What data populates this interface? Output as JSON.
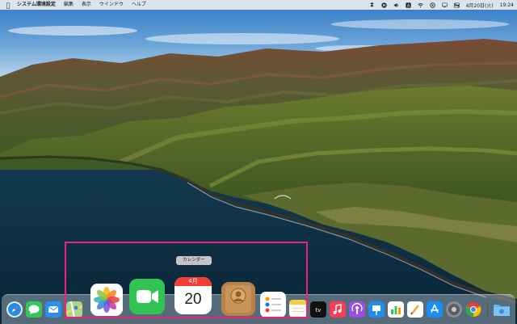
{
  "menubar": {
    "apple_glyph": "",
    "app_name": "システム環境設定",
    "menus": [
      "編集",
      "表示",
      "ウインドウ",
      "ヘルプ"
    ],
    "status_icons": [
      "dropbox-icon",
      "pause-icon",
      "sound-icon",
      "accessibility-icon",
      "wifi-icon",
      "siri-icon",
      "display-icon",
      "control-center-icon"
    ],
    "date": "4月20日(火)",
    "time": "19:24"
  },
  "tooltip": {
    "text": "カレンダー"
  },
  "dock": {
    "calendar_month": "4月",
    "calendar_day": "20",
    "apps": [
      "safari",
      "messages",
      "mail",
      "maps",
      "photos",
      "facetime",
      "calendar",
      "contacts",
      "reminders",
      "notes",
      "tv",
      "music",
      "podcasts",
      "keynote",
      "numbers",
      "pages",
      "app-store",
      "system-preferences",
      "chrome",
      "finder"
    ]
  },
  "colors": {
    "highlight": "#e8247e",
    "menubar_bg": "#ececee"
  }
}
